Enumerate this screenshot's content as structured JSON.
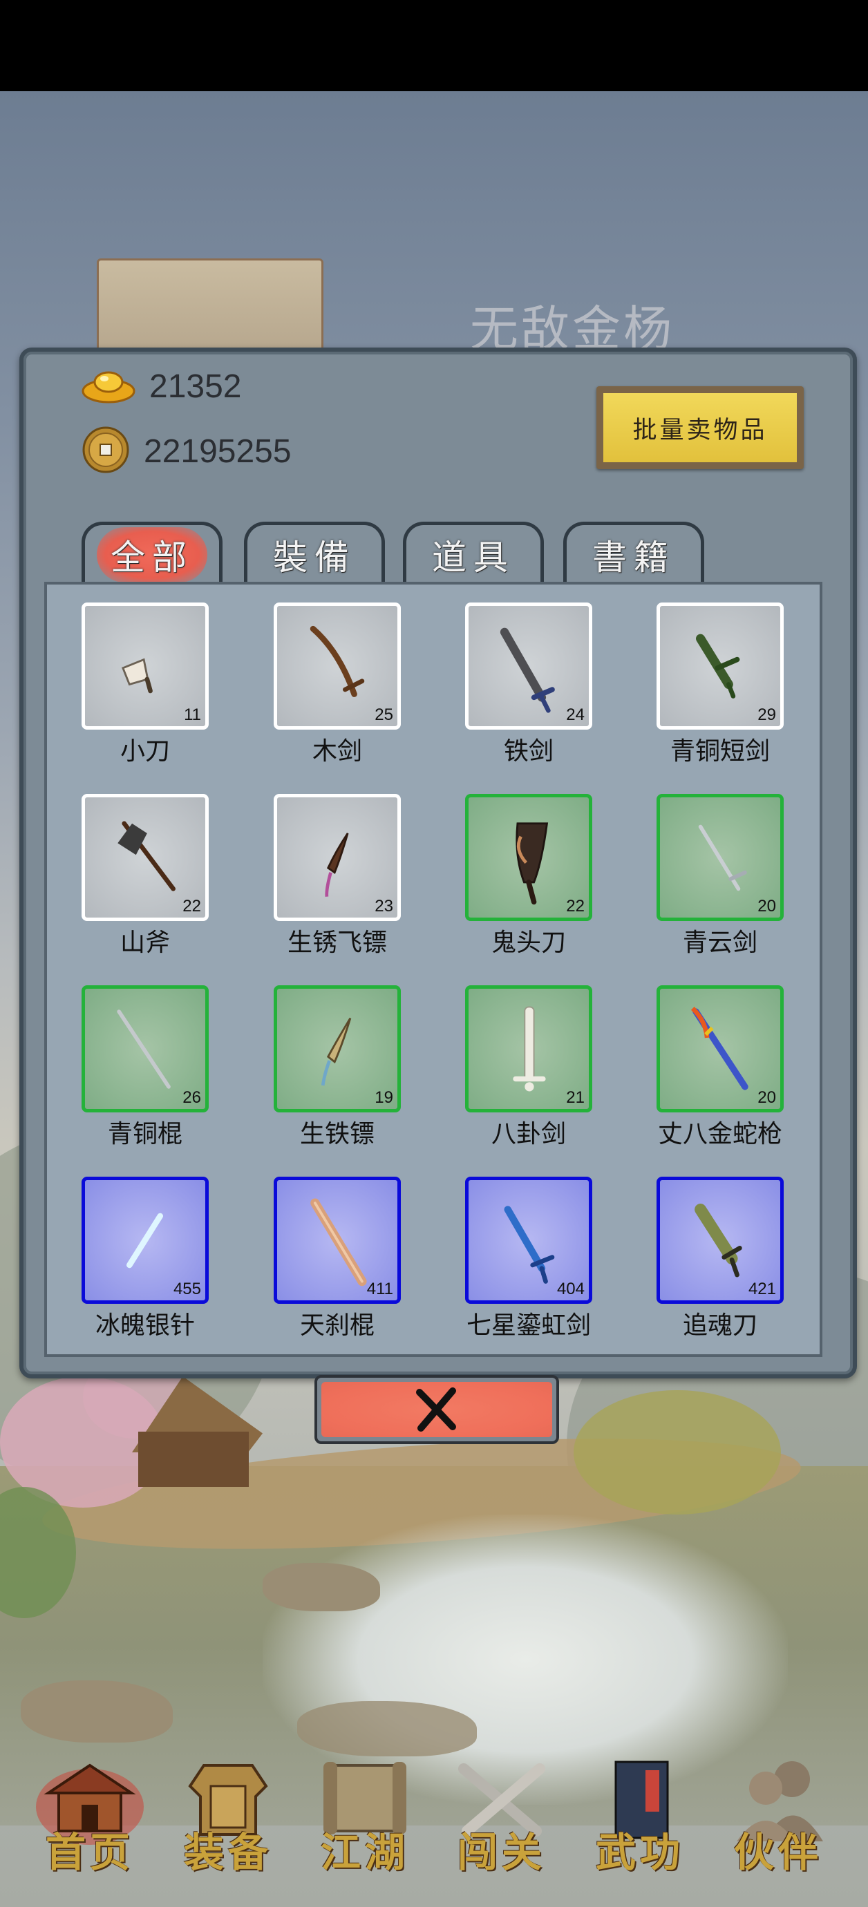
{
  "background": {
    "character_name": "无敌金杨"
  },
  "resources": {
    "gold_ingot": {
      "icon": "gold-ingot-icon",
      "value": "21352"
    },
    "copper_coin": {
      "icon": "copper-coin-icon",
      "value": "22195255"
    }
  },
  "sell_button": {
    "label": "批量卖物品"
  },
  "tabs": [
    {
      "label": "全部",
      "active": true
    },
    {
      "label": "裝備",
      "active": false
    },
    {
      "label": "道具",
      "active": false
    },
    {
      "label": "書籍",
      "active": false
    }
  ],
  "items": [
    {
      "name": "小刀",
      "count": "11",
      "rarity": "white",
      "icon": "dagger-icon"
    },
    {
      "name": "木剑",
      "count": "25",
      "rarity": "white",
      "icon": "wooden-sword-icon"
    },
    {
      "name": "铁剑",
      "count": "24",
      "rarity": "white",
      "icon": "iron-sword-icon"
    },
    {
      "name": "青铜短剑",
      "count": "29",
      "rarity": "white",
      "icon": "bronze-short-sword-icon"
    },
    {
      "name": "山斧",
      "count": "22",
      "rarity": "white",
      "icon": "axe-icon"
    },
    {
      "name": "生锈飞镖",
      "count": "23",
      "rarity": "white",
      "icon": "rusty-dart-icon"
    },
    {
      "name": "鬼头刀",
      "count": "22",
      "rarity": "green",
      "icon": "ghost-head-blade-icon"
    },
    {
      "name": "青云剑",
      "count": "20",
      "rarity": "green",
      "icon": "qingyun-sword-icon"
    },
    {
      "name": "青铜棍",
      "count": "26",
      "rarity": "green",
      "icon": "bronze-staff-icon"
    },
    {
      "name": "生铁镖",
      "count": "19",
      "rarity": "green",
      "icon": "iron-dart-icon"
    },
    {
      "name": "八卦剑",
      "count": "21",
      "rarity": "green",
      "icon": "bagua-sword-icon"
    },
    {
      "name": "丈八金蛇枪",
      "count": "20",
      "rarity": "green",
      "icon": "golden-snake-spear-icon"
    },
    {
      "name": "冰魄银针",
      "count": "455",
      "rarity": "blue",
      "icon": "ice-needle-icon"
    },
    {
      "name": "天刹棍",
      "count": "411",
      "rarity": "blue",
      "icon": "heaven-staff-icon"
    },
    {
      "name": "七星鎏虹剑",
      "count": "404",
      "rarity": "blue",
      "icon": "seven-star-sword-icon"
    },
    {
      "name": "追魂刀",
      "count": "421",
      "rarity": "blue",
      "icon": "soul-chaser-blade-icon"
    }
  ],
  "rarity_colors": {
    "white": "#ffffff",
    "green": "#24b23a",
    "blue": "#0a0ad9"
  },
  "close_button": {
    "icon": "close-x-icon"
  },
  "bottom_nav": [
    {
      "label": "首页",
      "icon": "house-icon"
    },
    {
      "label": "装备",
      "icon": "armor-icon"
    },
    {
      "label": "江湖",
      "icon": "scroll-icon"
    },
    {
      "label": "闯关",
      "icon": "crossed-swords-icon"
    },
    {
      "label": "武功",
      "icon": "book-icon"
    },
    {
      "label": "伙伴",
      "icon": "companions-icon"
    }
  ]
}
